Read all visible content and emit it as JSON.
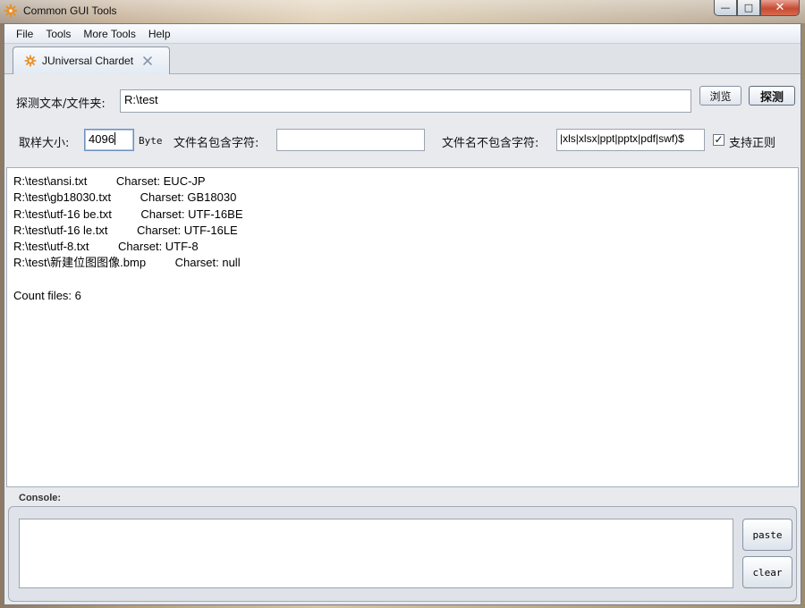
{
  "window": {
    "title": "Common GUI Tools",
    "buttons": {
      "minimize": "—",
      "maximize": "□",
      "close": "✕"
    }
  },
  "menu": [
    "File",
    "Tools",
    "More Tools",
    "Help"
  ],
  "tabs": [
    {
      "label": "JUniversal Chardet",
      "active": true
    }
  ],
  "detect": {
    "path_label": "探测文本/文件夹:",
    "path_value": "R:\\test",
    "browse_label": "浏览",
    "detect_label": "探测"
  },
  "options": {
    "sample_label": "取样大小:",
    "sample_value": "4096",
    "sample_unit": "Byte",
    "include_label": "文件名包含字符:",
    "include_value": "",
    "exclude_label": "文件名不包含字符:",
    "exclude_value": "|xls|xlsx|ppt|pptx|pdf|swf)$",
    "regex_label": "支持正则",
    "regex_checked": true,
    "check_mark": "✓"
  },
  "results": {
    "rows": [
      {
        "path": "R:\\test\\ansi.txt",
        "charset": "Charset: EUC-JP"
      },
      {
        "path": "R:\\test\\gb18030.txt",
        "charset": "Charset: GB18030"
      },
      {
        "path": "R:\\test\\utf-16 be.txt",
        "charset": "Charset: UTF-16BE"
      },
      {
        "path": "R:\\test\\utf-16 le.txt",
        "charset": "Charset: UTF-16LE"
      },
      {
        "path": "R:\\test\\utf-8.txt",
        "charset": "Charset: UTF-8"
      },
      {
        "path": "R:\\test\\新建位图图像.bmp",
        "charset": "Charset: null"
      }
    ],
    "summary": "Count files: 6"
  },
  "console": {
    "label": "Console:",
    "value": "",
    "paste_label": "paste",
    "clear_label": "clear"
  },
  "colors": {
    "accent_icon": "#e8902a",
    "frame": "#eeeeee",
    "close_button": "#c64c33"
  }
}
